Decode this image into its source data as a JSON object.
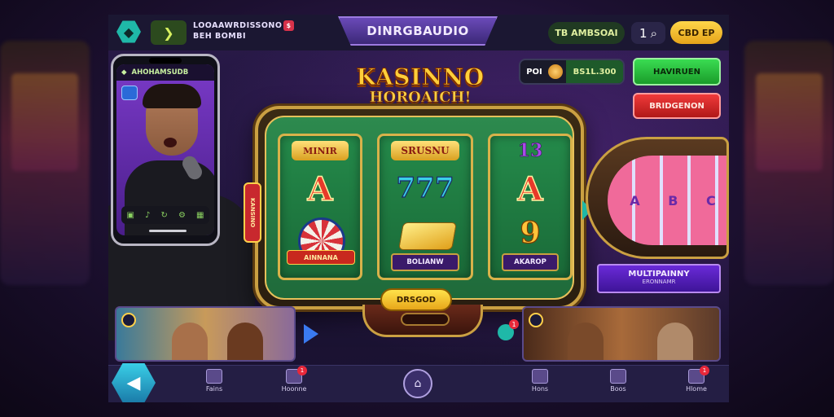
{
  "topbar": {
    "brand_line1": "LOOAAWRDISSONO",
    "brand_badge": "$",
    "brand_line2": "BEH BOMBI",
    "title": "DINRGBAUDIO",
    "balance": "TB AMBSOAI",
    "count": "1",
    "gold_button": "CBD EP"
  },
  "phone": {
    "header": "AHOHAMSUDB"
  },
  "logo": {
    "line1": "KASINNO",
    "line2": "HOROAICH!"
  },
  "reels": [
    {
      "head": "MINIR",
      "symbol": "A",
      "tag": ""
    },
    {
      "head": "SRUSNU",
      "symbol": "777",
      "tag": "BOLIANW"
    },
    {
      "head": "13",
      "symbol": "A",
      "symbol2": "9",
      "tag": "AKAROP"
    }
  ],
  "chip_banner": "AINNANA",
  "side_tab": "KANSINO",
  "spin_label": "DRSGOD",
  "right_panel": {
    "bal_label": "POI",
    "bal_value": "BS1L.300",
    "green_button": "HAVIRUEN",
    "red_button": "BRIDGENON",
    "wheel_symbols": [
      "A",
      "B",
      "C"
    ],
    "multi_line1": "MULTIPAINNY",
    "multi_line2": "ERONNAMR"
  },
  "notif_count": "1",
  "bottomnav": {
    "items": [
      {
        "label": "Fains",
        "badge": ""
      },
      {
        "label": "Hoonne",
        "badge": "1"
      },
      {
        "label": "",
        "badge": ""
      },
      {
        "label": "Hons",
        "badge": ""
      },
      {
        "label": "Boos",
        "badge": ""
      },
      {
        "label": "Hlome",
        "badge": "1"
      }
    ]
  },
  "colors": {
    "accent_teal": "#1fb8a8",
    "gold": "#ffd64a",
    "felt_green": "#248a4a",
    "purple": "#6a2ad8"
  }
}
